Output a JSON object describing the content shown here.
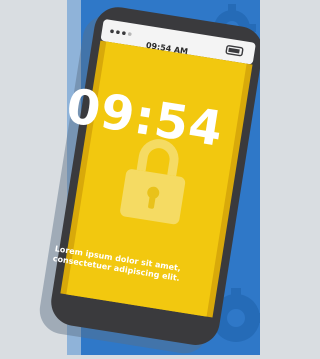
{
  "phone": {
    "status_time": "09:54 AM",
    "lock_time": "09:54",
    "caption": "Lorem ipsum dolor sit amet, consectetuer adipiscing elit."
  },
  "icons": {
    "lock": "padlock-icon",
    "battery": "battery-icon",
    "signal": "signal-dots-icon",
    "gear": "gear-icon"
  },
  "colors": {
    "screen": "#f2c80f",
    "screen_edge": "#d8a90a",
    "phone_body": "#3a3a3d",
    "background_blue": "#2f78c8",
    "side_panel": "#8fb3d9"
  }
}
